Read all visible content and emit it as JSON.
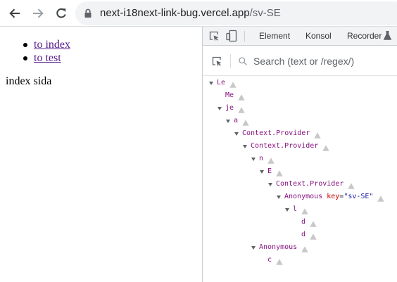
{
  "browser": {
    "url_host": "next-i18next-link-bug.vercel.app",
    "url_path": "/sv-SE"
  },
  "page": {
    "links": [
      "to index",
      "to test"
    ],
    "heading": "index sida"
  },
  "devtools": {
    "tabs": [
      "Element",
      "Konsol",
      "Recorder"
    ],
    "search_placeholder": "Search (text or /regex/)",
    "tree": [
      {
        "label": "Le",
        "depth": 0,
        "expanded": true
      },
      {
        "label": "Me",
        "depth": 1,
        "expanded": false
      },
      {
        "label": "je",
        "depth": 1,
        "expanded": true
      },
      {
        "label": "a",
        "depth": 2,
        "expanded": true
      },
      {
        "label": "Context.Provider",
        "depth": 3,
        "expanded": true
      },
      {
        "label": "Context.Provider",
        "depth": 4,
        "expanded": true
      },
      {
        "label": "n",
        "depth": 5,
        "expanded": true
      },
      {
        "label": "E",
        "depth": 6,
        "expanded": true
      },
      {
        "label": "Context.Provider",
        "depth": 7,
        "expanded": true
      },
      {
        "label": "Anonymous",
        "depth": 8,
        "expanded": true,
        "key": "sv-SE"
      },
      {
        "label": "l",
        "depth": 9,
        "expanded": true
      },
      {
        "label": "d",
        "depth": 10,
        "expanded": false
      },
      {
        "label": "d",
        "depth": 10,
        "expanded": false
      },
      {
        "label": "Anonymous",
        "depth": 5,
        "expanded": true
      },
      {
        "label": "c",
        "depth": 6,
        "expanded": false
      }
    ]
  },
  "colors": {
    "component": "#881280",
    "attr_name": "#c80000",
    "attr_value": "#1a1aa6",
    "link_visited": "#551a8b"
  }
}
